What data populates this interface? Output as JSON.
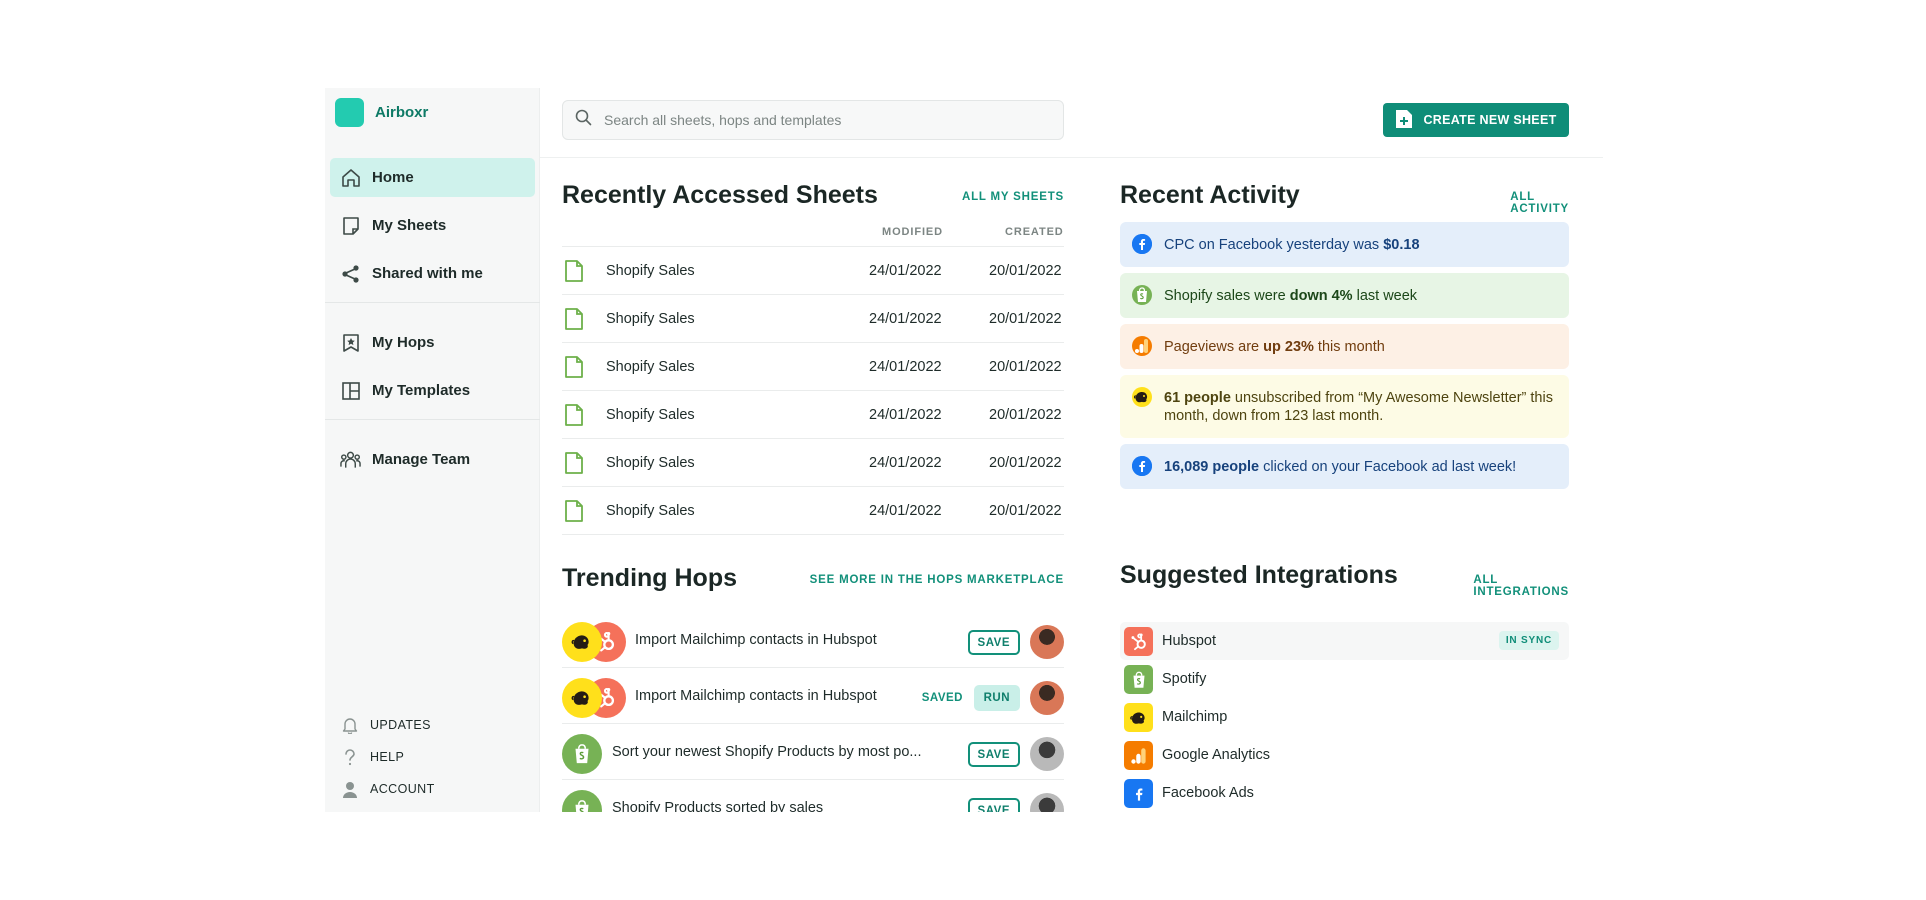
{
  "app": {
    "name": "Airboxr",
    "brand_color": "#23cbb0",
    "accent": "#0f8d78"
  },
  "sidebar": {
    "nav_groups": [
      [
        {
          "label": "Home",
          "icon": "home-icon",
          "active": true
        },
        {
          "label": "My Sheets",
          "icon": "sheet-icon",
          "active": false
        },
        {
          "label": "Shared with me",
          "icon": "share-icon",
          "active": false
        }
      ],
      [
        {
          "label": "My Hops",
          "icon": "bookmark-star-icon",
          "active": false
        },
        {
          "label": "My Templates",
          "icon": "template-icon",
          "active": false
        }
      ],
      [
        {
          "label": "Manage Team",
          "icon": "team-icon",
          "active": false
        }
      ]
    ],
    "footer": [
      {
        "label": "UPDATES",
        "icon": "bell-icon"
      },
      {
        "label": "HELP",
        "icon": "question-icon"
      },
      {
        "label": "ACCOUNT",
        "icon": "user-icon"
      }
    ]
  },
  "search": {
    "placeholder": "Search all sheets, hops and templates"
  },
  "create_button": {
    "label": "CREATE NEW SHEET"
  },
  "sheets": {
    "title": "Recently Accessed Sheets",
    "link": "ALL MY SHEETS",
    "columns": {
      "modified": "MODIFIED",
      "created": "CREATED"
    },
    "rows": [
      {
        "name": "Shopify Sales",
        "modified": "24/01/2022",
        "created": "20/01/2022"
      },
      {
        "name": "Shopify Sales",
        "modified": "24/01/2022",
        "created": "20/01/2022"
      },
      {
        "name": "Shopify Sales",
        "modified": "24/01/2022",
        "created": "20/01/2022"
      },
      {
        "name": "Shopify Sales",
        "modified": "24/01/2022",
        "created": "20/01/2022"
      },
      {
        "name": "Shopify Sales",
        "modified": "24/01/2022",
        "created": "20/01/2022"
      },
      {
        "name": "Shopify Sales",
        "modified": "24/01/2022",
        "created": "20/01/2022"
      }
    ]
  },
  "activity": {
    "title": "Recent Activity",
    "link": "ALL ACTIVITY",
    "items": [
      {
        "style": "blue",
        "icon": "facebook-icon",
        "parts": [
          {
            "t": "CPC on Facebook yesterday was "
          },
          {
            "t": "$0.18",
            "b": true
          }
        ]
      },
      {
        "style": "green",
        "icon": "shopify-icon",
        "parts": [
          {
            "t": "Shopify sales were "
          },
          {
            "t": "down 4%",
            "b": true
          },
          {
            "t": " last week"
          }
        ]
      },
      {
        "style": "orange",
        "icon": "analytics-icon",
        "parts": [
          {
            "t": "Pageviews are "
          },
          {
            "t": "up 23%",
            "b": true
          },
          {
            "t": " this month"
          }
        ]
      },
      {
        "style": "yellow",
        "icon": "mailchimp-icon",
        "parts": [
          {
            "t": "61 people",
            "b": true
          },
          {
            "t": " unsubscribed from “My Awesome Newsletter” this month, down from 123 last month."
          }
        ]
      },
      {
        "style": "blue2",
        "icon": "facebook-icon",
        "parts": [
          {
            "t": "16,089 people",
            "b": true
          },
          {
            "t": " clicked on your Facebook ad last week!"
          }
        ]
      }
    ]
  },
  "hops": {
    "title": "Trending Hops",
    "link": "SEE MORE IN THE HOPS MARKETPLACE",
    "items": [
      {
        "title": "Import Mailchimp contacts in Hubspot",
        "logos": [
          "mailchimp",
          "hubspot"
        ],
        "action": "SAVE",
        "saved_label": "",
        "avatar": "dark"
      },
      {
        "title": "Import Mailchimp contacts in Hubspot",
        "logos": [
          "mailchimp",
          "hubspot"
        ],
        "action": "RUN",
        "saved_label": "SAVED",
        "avatar": "dark"
      },
      {
        "title": "Sort your newest Shopify Products by most po...",
        "logos": [
          "shopify"
        ],
        "action": "SAVE",
        "saved_label": "",
        "avatar": "grey"
      },
      {
        "title": "Shopify Products sorted by sales",
        "logos": [
          "shopify"
        ],
        "action": "SAVE",
        "saved_label": "",
        "avatar": "grey"
      }
    ]
  },
  "integrations": {
    "title": "Suggested Integrations",
    "link": "ALL INTEGRATIONS",
    "items": [
      {
        "name": "Hubspot",
        "icon": "hubspot",
        "status": "IN SYNC"
      },
      {
        "name": "Spotify",
        "icon": "shopify",
        "status": ""
      },
      {
        "name": "Mailchimp",
        "icon": "mailchimp",
        "status": ""
      },
      {
        "name": "Google Analytics",
        "icon": "analytics",
        "status": ""
      },
      {
        "name": "Facebook Ads",
        "icon": "facebook",
        "status": ""
      }
    ]
  }
}
